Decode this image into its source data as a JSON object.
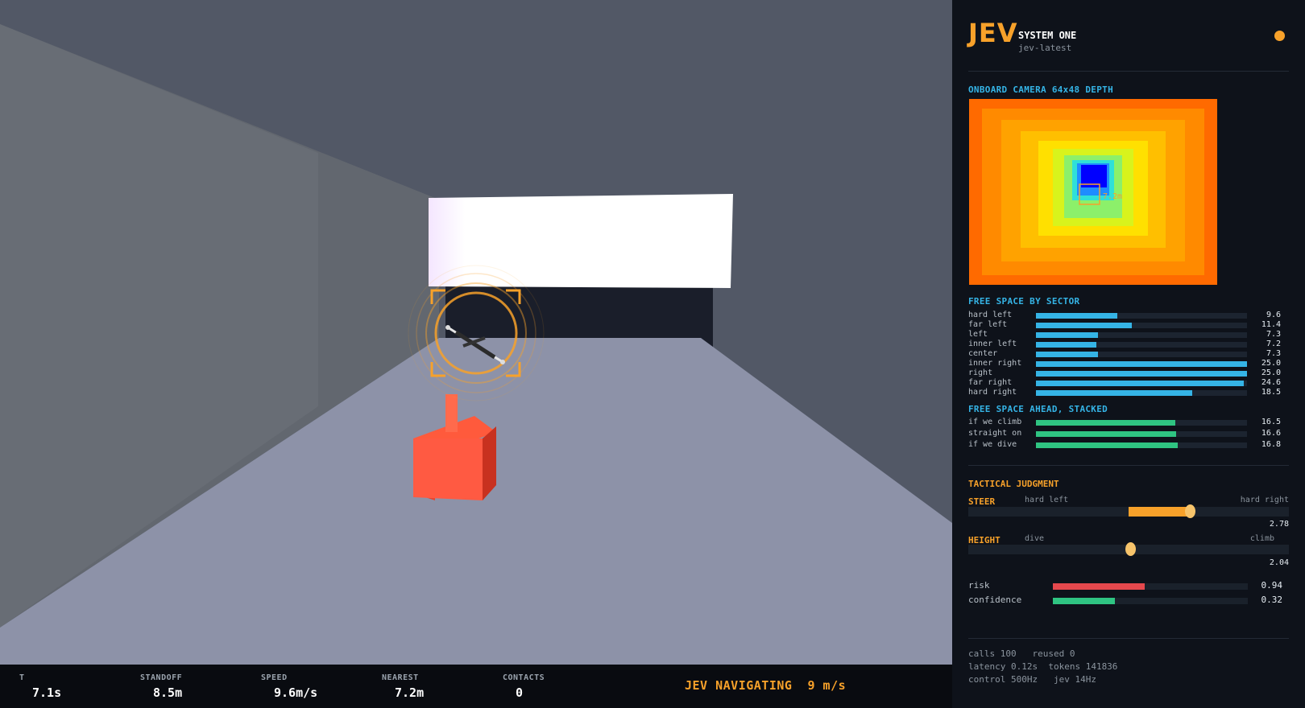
{
  "hud": {
    "stats": [
      {
        "label": "T",
        "value": "7.1s"
      },
      {
        "label": "STANDOFF",
        "value": "8.5m"
      },
      {
        "label": "SPEED",
        "value": "9.6m/s"
      },
      {
        "label": "NEAREST",
        "value": "7.2m"
      },
      {
        "label": "CONTACTS",
        "value": "0"
      }
    ],
    "status": "JEV NAVIGATING  9 m/s"
  },
  "panel": {
    "logo": "JEV",
    "system_name": "SYSTEM ONE",
    "version": "jev-latest",
    "camera_title": "ONBOARD CAMERA  64x48 DEPTH",
    "camera_marker_label": "7.2m",
    "sector_title": "FREE SPACE BY SECTOR",
    "sectors": [
      {
        "label": "hard left",
        "value": "9.6",
        "fraction": 0.384
      },
      {
        "label": "far left",
        "value": "11.4",
        "fraction": 0.456
      },
      {
        "label": "left",
        "value": "7.3",
        "fraction": 0.292
      },
      {
        "label": "inner left",
        "value": "7.2",
        "fraction": 0.288
      },
      {
        "label": "center",
        "value": "7.3",
        "fraction": 0.292
      },
      {
        "label": "inner right",
        "value": "25.0",
        "fraction": 1.0
      },
      {
        "label": "right",
        "value": "25.0",
        "fraction": 1.0
      },
      {
        "label": "far right",
        "value": "24.6",
        "fraction": 0.984
      },
      {
        "label": "hard right",
        "value": "18.5",
        "fraction": 0.74
      }
    ],
    "ahead_title": "FREE SPACE AHEAD, STACKED",
    "ahead": [
      {
        "label": "if we climb",
        "value": "16.5",
        "fraction": 0.66
      },
      {
        "label": "straight on",
        "value": "16.6",
        "fraction": 0.664
      },
      {
        "label": "if we dive",
        "value": "16.8",
        "fraction": 0.672
      }
    ],
    "tactical_title": "TACTICAL JUDGMENT",
    "steer": {
      "name": "STEER",
      "min_label": "hard left",
      "max_label": "hard right",
      "value": "2.78",
      "position": 0.69
    },
    "height": {
      "name": "HEIGHT",
      "min_label": "dive",
      "max_label": "climb",
      "value": "2.04",
      "position": 0.504
    },
    "metrics": [
      {
        "label": "risk",
        "value": "0.94",
        "fraction": 0.47,
        "color": "#e5484d"
      },
      {
        "label": "confidence",
        "value": "0.32",
        "fraction": 0.32,
        "color": "#2fc482"
      }
    ],
    "footer": [
      "calls 100   reused 0",
      "latency 0.12s  tokens 141836",
      "control 500Hz   jev 14Hz"
    ]
  },
  "colors": {
    "accent": "#f7a12a",
    "info": "#35b4e6",
    "good": "#2fc482",
    "bad": "#e5484d"
  }
}
